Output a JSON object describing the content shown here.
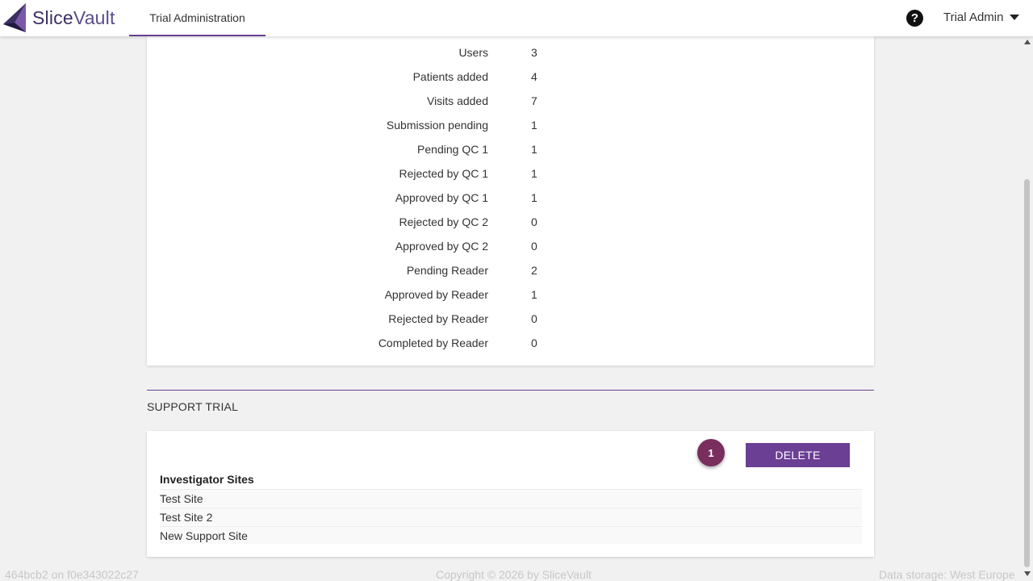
{
  "header": {
    "brand": "SliceVault",
    "brand_part1": "Slice",
    "brand_part2": "Vault",
    "nav_tab": "Trial Administration",
    "help_icon_glyph": "?",
    "user_menu": "Trial Admin"
  },
  "stats": [
    {
      "label": "Users",
      "value": "3"
    },
    {
      "label": "Patients added",
      "value": "4"
    },
    {
      "label": "Visits added",
      "value": "7"
    },
    {
      "label": "Submission pending",
      "value": "1"
    },
    {
      "label": "Pending QC 1",
      "value": "1"
    },
    {
      "label": "Rejected by QC 1",
      "value": "1"
    },
    {
      "label": "Approved by QC 1",
      "value": "1"
    },
    {
      "label": "Rejected by QC 2",
      "value": "0"
    },
    {
      "label": "Approved by QC 2",
      "value": "0"
    },
    {
      "label": "Pending Reader",
      "value": "2"
    },
    {
      "label": "Approved by Reader",
      "value": "1"
    },
    {
      "label": "Rejected by Reader",
      "value": "0"
    },
    {
      "label": "Completed by Reader",
      "value": "0"
    }
  ],
  "support": {
    "section_title": "SUPPORT TRIAL",
    "badge_count": "1",
    "delete_label": "DELETE",
    "sites_heading": "Investigator Sites",
    "sites": [
      "Test Site",
      "Test Site 2",
      "New Support Site"
    ]
  },
  "footer": {
    "build": "464bcb2 on f0e343022c27",
    "copyright": "Copyright © 2026 by SliceVault",
    "storage": "Data storage: West Europe"
  },
  "colors": {
    "accent": "#6b3f94",
    "badge": "#7a2e5f",
    "background": "#f1f1f1"
  }
}
